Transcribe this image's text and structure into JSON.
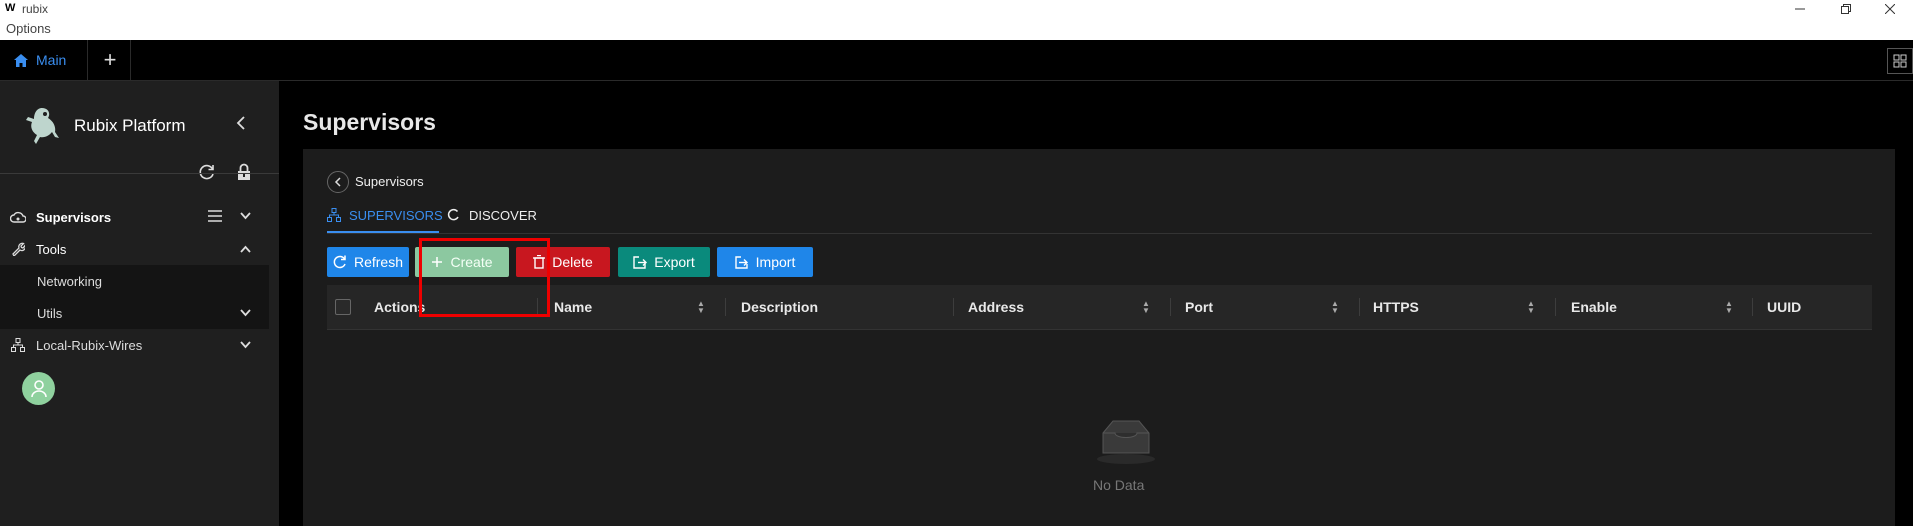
{
  "window": {
    "logo": "W",
    "title": "rubix",
    "menu": "Options"
  },
  "tabs": {
    "main_label": "Main",
    "add_label": "+"
  },
  "sidebar": {
    "brand": "Rubix Platform",
    "items": [
      {
        "label": "Supervisors"
      },
      {
        "label": "Tools"
      },
      {
        "label": "Networking"
      },
      {
        "label": "Utils"
      },
      {
        "label": "Local-Rubix-Wires"
      }
    ]
  },
  "page": {
    "title": "Supervisors",
    "breadcrumb": "Supervisors",
    "tabs": [
      {
        "label": "SUPERVISORS"
      },
      {
        "label": "DISCOVER"
      }
    ],
    "buttons": {
      "refresh": "Refresh",
      "create": "Create",
      "delete": "Delete",
      "export": "Export",
      "import": "Import"
    },
    "table": {
      "columns": [
        "Actions",
        "Name",
        "Description",
        "Address",
        "Port",
        "HTTPS",
        "Enable",
        "UUID"
      ],
      "rows": [],
      "empty_text": "No Data"
    }
  },
  "colors": {
    "accent": "#1f86e9",
    "create": "#8cc8a0",
    "delete": "#c8171f",
    "export": "#0a8a7c",
    "highlight": "#e00000"
  }
}
